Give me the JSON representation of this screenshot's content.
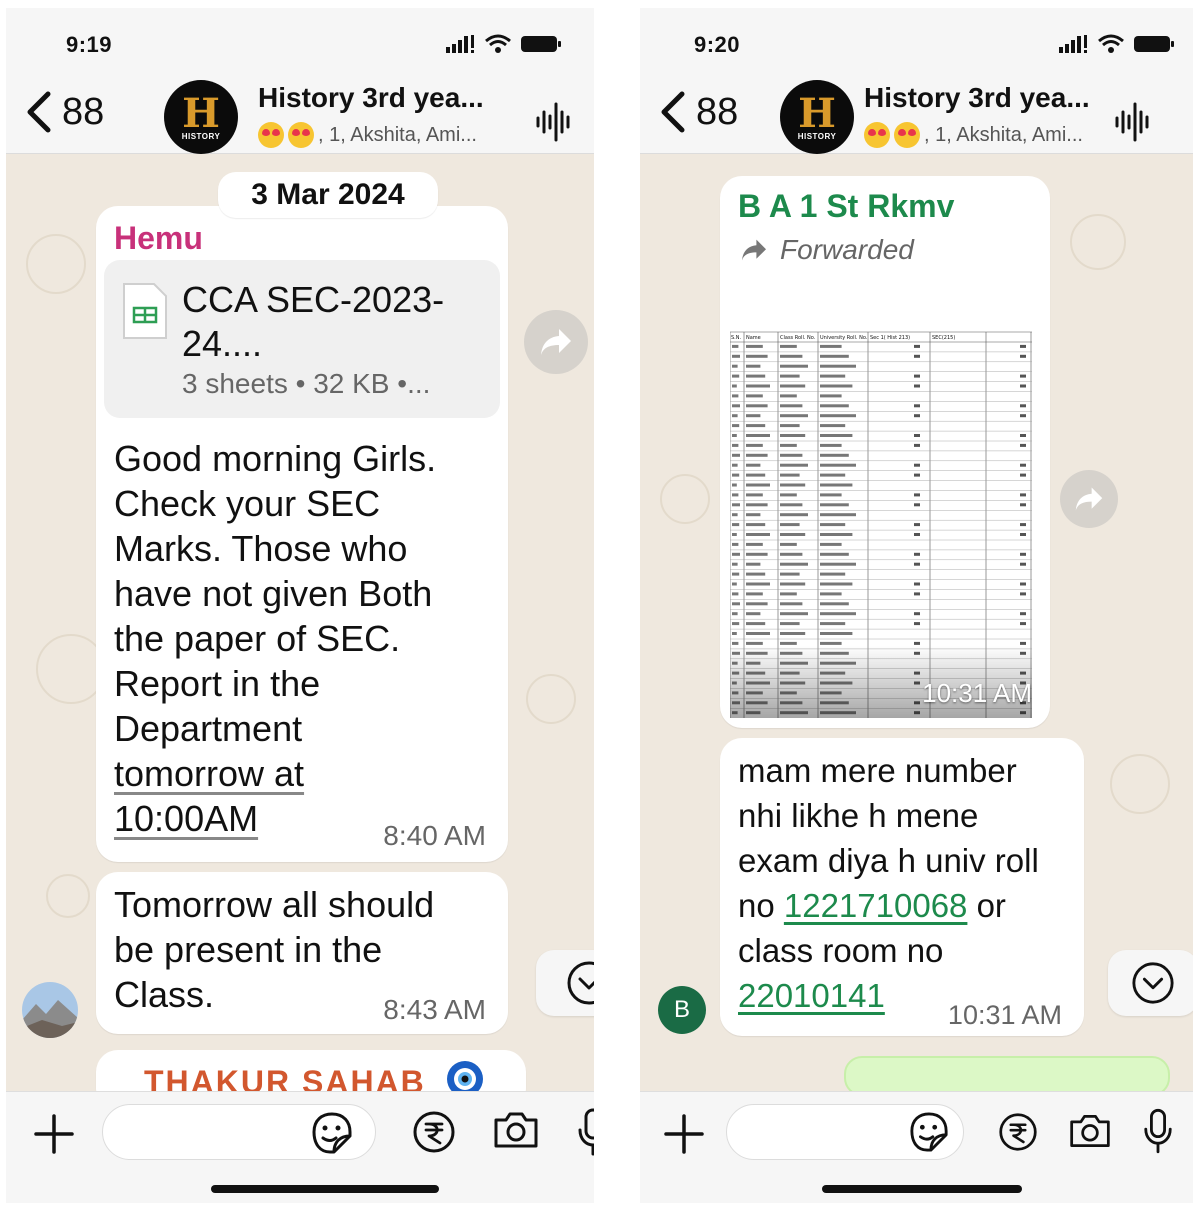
{
  "left": {
    "status": {
      "time": "9:19"
    },
    "header": {
      "back_count": "88",
      "title": "History 3rd yea...",
      "members": ", 1, Akshita, Ami...",
      "avatar_letter": "H",
      "avatar_label": "HISTORY"
    },
    "date_chip": "3 Mar 2024",
    "messages": [
      {
        "sender": "Hemu",
        "document": {
          "name": "CCA SEC-2023-24....",
          "meta": "3 sheets • 32 KB •..."
        },
        "text_lines": [
          "Good morning Girls.",
          "Check your SEC",
          "Marks. Those who",
          "have not given Both",
          "the paper of SEC.",
          "Report in the",
          "Department"
        ],
        "link_lines": [
          "tomorrow at",
          "10:00AM"
        ],
        "time": "8:40 AM"
      },
      {
        "text_lines": [
          "Tomorrow all should",
          "be present in the",
          "Class."
        ],
        "time": "8:43 AM"
      }
    ],
    "partial_sender": "THAKUR SAHAB"
  },
  "right": {
    "status": {
      "time": "9:20"
    },
    "header": {
      "back_count": "88",
      "title": "History 3rd yea...",
      "members": ", 1, Akshita, Ami...",
      "avatar_letter": "H",
      "avatar_label": "HISTORY"
    },
    "forwarded_msg": {
      "title": "B A 1 St Rkmv",
      "forwarded_label": "Forwarded",
      "time": "10:31 AM",
      "table_headers": [
        "S.N.",
        "Name",
        "Class Roll. No.",
        "University Roll. No.",
        "Sec 1( Hist 213)",
        "SEC(215)"
      ]
    },
    "reply_msg": {
      "avatar_letter": "B",
      "line1": "mam mere number",
      "line2": "nhi likhe h mene",
      "line3": "exam diya h univ roll",
      "line4_prefix": "no ",
      "link1": "1221710068",
      "line4_suffix": " or",
      "line5": "class room no",
      "link2": "22010141",
      "time": "10:31 AM"
    }
  },
  "colors": {
    "sender": "#c8317a",
    "forward_title": "#1d8a4c",
    "chat_bg": "#efe8de",
    "link": "#1d8a4c"
  },
  "icons": [
    "chevron-left-icon",
    "waveform-icon",
    "forward-icon",
    "chevron-down-icon",
    "plus-icon",
    "sticker-icon",
    "rupee-icon",
    "camera-icon",
    "microphone-icon",
    "spreadsheet-icon",
    "signal-icon",
    "wifi-icon",
    "battery-icon"
  ]
}
